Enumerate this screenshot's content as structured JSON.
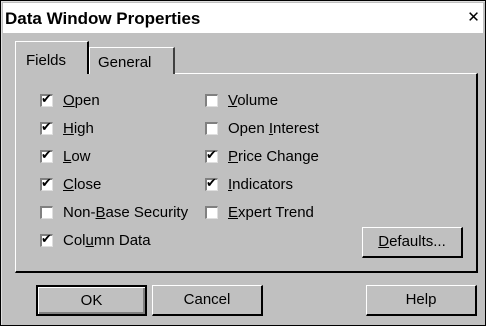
{
  "window": {
    "title": "Data Window Properties",
    "close_glyph": "✕"
  },
  "tabs": [
    {
      "label": "Fields",
      "selected": true
    },
    {
      "label": "General",
      "selected": false
    }
  ],
  "fields_left": [
    {
      "pre": "",
      "mn": "O",
      "post": "pen",
      "checked": true
    },
    {
      "pre": "",
      "mn": "H",
      "post": "igh",
      "checked": true
    },
    {
      "pre": "",
      "mn": "L",
      "post": "ow",
      "checked": true
    },
    {
      "pre": "",
      "mn": "C",
      "post": "lose",
      "checked": true
    },
    {
      "pre": "Non-",
      "mn": "B",
      "post": "ase Security",
      "checked": false
    },
    {
      "pre": "Col",
      "mn": "u",
      "post": "mn Data",
      "checked": true
    }
  ],
  "fields_right": [
    {
      "pre": "",
      "mn": "V",
      "post": "olume",
      "checked": false
    },
    {
      "pre": "Open ",
      "mn": "I",
      "post": "nterest",
      "checked": false
    },
    {
      "pre": "",
      "mn": "P",
      "post": "rice Change",
      "checked": true
    },
    {
      "pre": "",
      "mn": "I",
      "post": "ndicators",
      "checked": true
    },
    {
      "pre": "",
      "mn": "E",
      "post": "xpert Trend",
      "checked": false
    }
  ],
  "defaults_button": {
    "pre": "",
    "mn": "D",
    "post": "efaults..."
  },
  "buttons": {
    "ok": "OK",
    "cancel": "Cancel",
    "help": "Help"
  },
  "check_glyph": "✔"
}
